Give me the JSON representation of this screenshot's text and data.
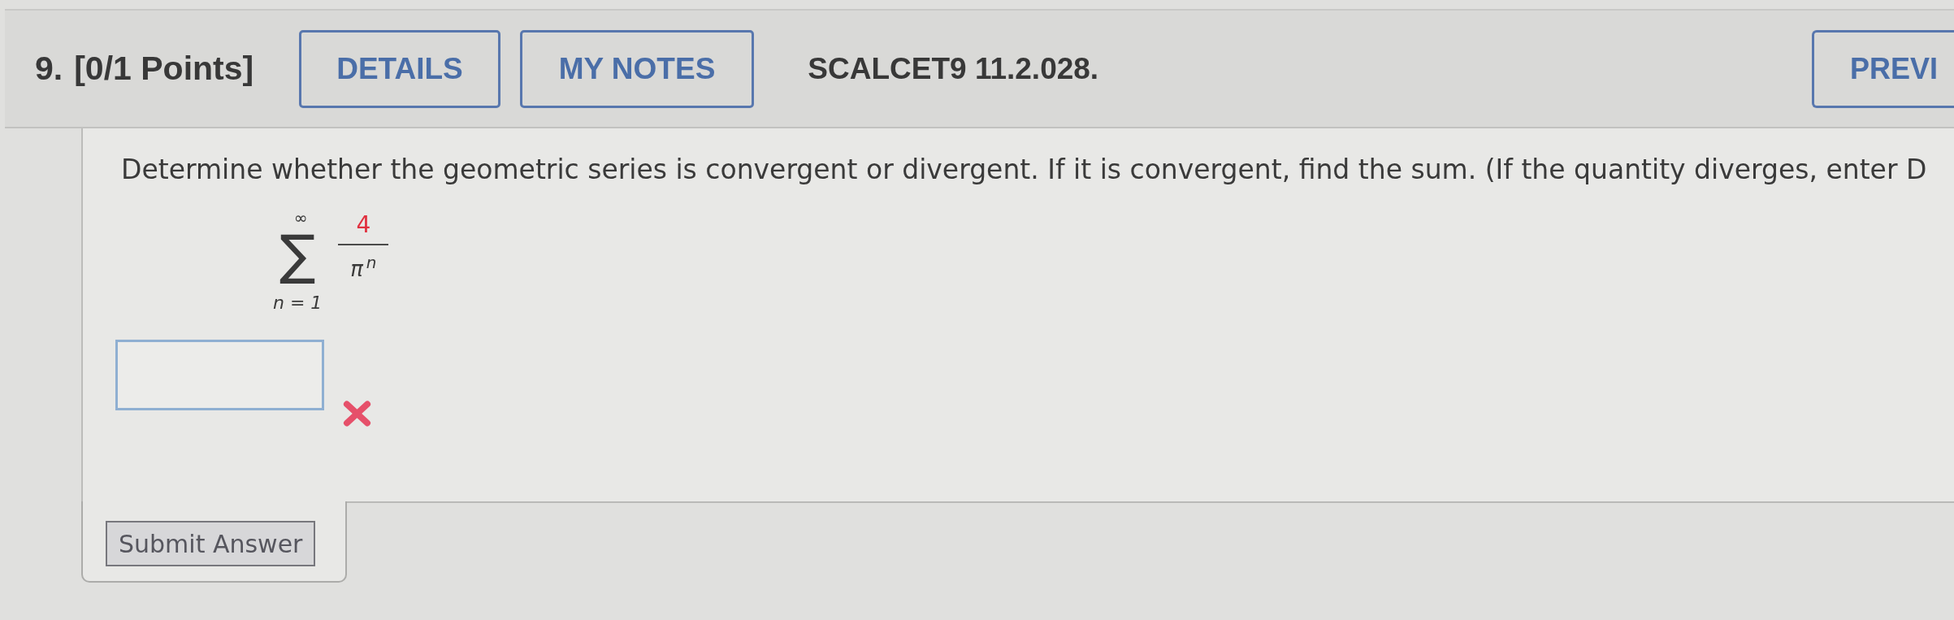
{
  "header": {
    "number": "9.",
    "points": "[0/1 Points]",
    "buttons": [
      "DETAILS",
      "MY NOTES"
    ],
    "code": "SCALCET9 11.2.028.",
    "previous_button": "PREVI"
  },
  "question": {
    "prompt": "Determine whether the geometric series is convergent or divergent. If it is convergent, find the sum. (If the quantity diverges, enter D",
    "series": {
      "operator": "∑",
      "upper": "∞",
      "lower": "n = 1",
      "numerator": "4",
      "denominator": "π$^{n}$"
    },
    "answer": {
      "correct": false
    },
    "submit_button": "Submit Answer"
  }
}
